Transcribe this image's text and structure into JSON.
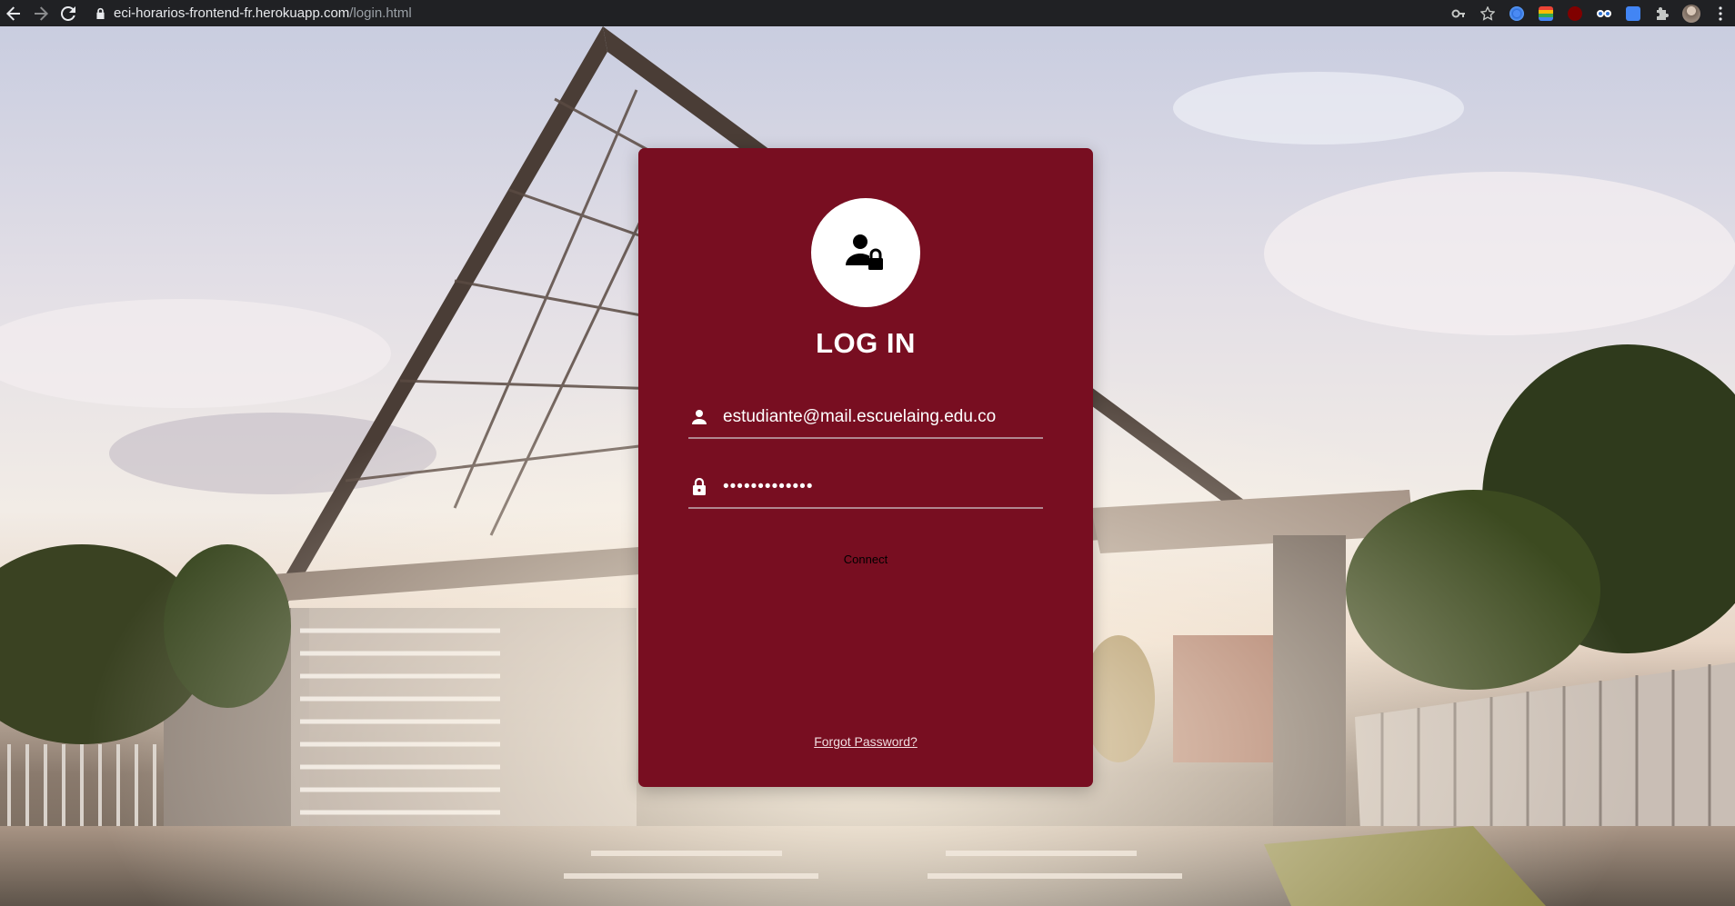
{
  "browser": {
    "url_host": "eci-horarios-frontend-fr.herokuapp.com",
    "url_path": "/login.html",
    "back_icon": "arrow-left-icon",
    "forward_icon": "arrow-right-icon",
    "reload_icon": "reload-icon",
    "secure_icon": "lock-icon",
    "extensions": [
      "key-icon",
      "star-icon",
      "chrome-ext-icon",
      "sheets-ext-icon",
      "ublock-icon",
      "ext-eyes-icon",
      "translate-icon",
      "puzzle-icon",
      "profile-avatar",
      "menu-dots-icon"
    ]
  },
  "login": {
    "header_icon": "user-lock-icon",
    "title": "LOG IN",
    "username": {
      "icon": "person-icon",
      "value": "estudiante@mail.escuelaing.edu.co"
    },
    "password": {
      "icon": "lock-icon",
      "value": "•••••••••••••"
    },
    "connect_label": "Connect",
    "forgot_label": "Forgot Password?"
  },
  "colors": {
    "card": "#780e21",
    "browser_bar": "#202124"
  }
}
